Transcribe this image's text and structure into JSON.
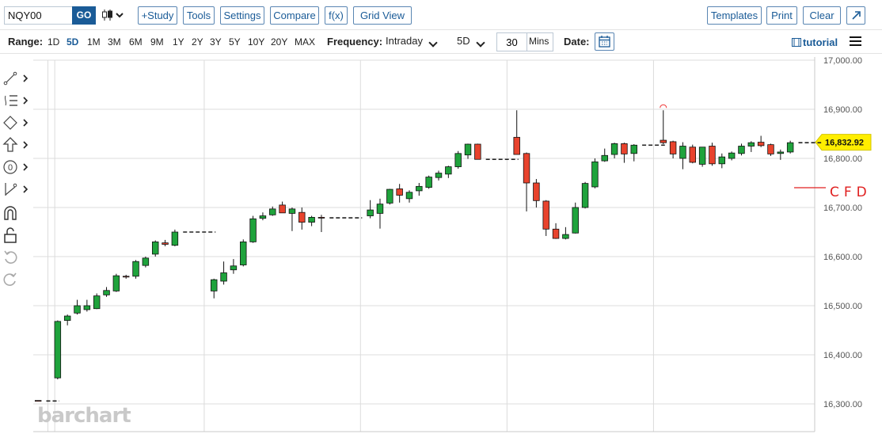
{
  "toolbar": {
    "symbol_value": "NQY00",
    "go_label": "GO",
    "study_label": "+Study",
    "tools_label": "Tools",
    "settings_label": "Settings",
    "compare_label": "Compare",
    "fx_label": "f(x)",
    "gridview_label": "Grid View",
    "templates_label": "Templates",
    "print_label": "Print",
    "clear_label": "Clear",
    "expand_icon": "expand-icon"
  },
  "range_bar": {
    "range_label": "Range:",
    "ranges": [
      "1D",
      "5D",
      "1M",
      "3M",
      "6M",
      "9M",
      "1Y",
      "2Y",
      "3Y",
      "5Y",
      "10Y",
      "20Y",
      "MAX"
    ],
    "active_range": "5D",
    "frequency_label": "Frequency:",
    "frequency_value": "Intraday",
    "period_value": "5D",
    "interval_value": "30",
    "interval_unit": "Mins",
    "date_label": "Date:",
    "tutorial_label": "tutorial"
  },
  "watermark": "barchart",
  "colors": {
    "up": "#1fa33c",
    "down": "#e8432d",
    "accent": "#1a5b97",
    "price_tag": "#ffee00"
  },
  "chart_data": {
    "type": "candlestick",
    "ylim": [
      16285,
      17015
    ],
    "yticks": [
      16300,
      16400,
      16500,
      16600,
      16700,
      16800,
      16900,
      17000
    ],
    "ytick_labels": [
      "16,300.00",
      "16,400.00",
      "16,500.00",
      "16,600.00",
      "16,700.00",
      "16,800.00",
      "16,900.00",
      "17,000.00"
    ],
    "last_price_label": "16,832.92",
    "last_price": 16832.92,
    "annotation_text": "CFD",
    "x_slots": 80,
    "segments": [
      {
        "start": 0,
        "ohlc": [
          [
            16307,
            16307,
            16306,
            16306
          ]
        ],
        "tail": [
          1,
          2
        ]
      },
      {
        "start": 2,
        "ohlc": [
          [
            16353,
            16470,
            16350,
            16468
          ],
          [
            16470,
            16482,
            16460,
            16479
          ],
          [
            16485,
            16512,
            16482,
            16500
          ],
          [
            16492,
            16512,
            16488,
            16500
          ],
          [
            16494,
            16525,
            16493,
            16520
          ],
          [
            16522,
            16538,
            16518,
            16531
          ],
          [
            16530,
            16565,
            16528,
            16561
          ],
          [
            16560,
            16563,
            16555,
            16559
          ],
          [
            16560,
            16593,
            16555,
            16590
          ],
          [
            16582,
            16600,
            16578,
            16597
          ],
          [
            16605,
            16633,
            16600,
            16630
          ],
          [
            16628,
            16634,
            16621,
            16625
          ],
          [
            16623,
            16655,
            16621,
            16650
          ]
        ],
        "tail": [
          15,
          18
        ]
      },
      {
        "start": 18,
        "ohlc": [
          [
            16530,
            16555,
            16515,
            16553
          ],
          [
            16550,
            16590,
            16543,
            16567
          ],
          [
            16573,
            16595,
            16565,
            16581
          ],
          [
            16583,
            16635,
            16580,
            16630
          ],
          [
            16630,
            16683,
            16628,
            16677
          ],
          [
            16678,
            16690,
            16674,
            16683
          ],
          [
            16685,
            16702,
            16683,
            16697
          ],
          [
            16705,
            16712,
            16691,
            16689
          ],
          [
            16688,
            16700,
            16652,
            16697
          ],
          [
            16690,
            16700,
            16655,
            16670
          ],
          [
            16670,
            16683,
            16662,
            16680
          ],
          [
            16680,
            16685,
            16650,
            16679
          ]
        ],
        "tail": [
          30,
          33
        ]
      },
      {
        "start": 34,
        "ohlc": [
          [
            16683,
            16715,
            16678,
            16695
          ],
          [
            16688,
            16718,
            16657,
            16707
          ],
          [
            16709,
            16738,
            16706,
            16737
          ],
          [
            16738,
            16748,
            16710,
            16725
          ],
          [
            16718,
            16735,
            16710,
            16731
          ],
          [
            16734,
            16750,
            16724,
            16743
          ],
          [
            16741,
            16765,
            16738,
            16762
          ],
          [
            16761,
            16775,
            16755,
            16770
          ],
          [
            16768,
            16785,
            16760,
            16783
          ],
          [
            16783,
            16815,
            16779,
            16810
          ],
          [
            16807,
            16830,
            16799,
            16829
          ],
          [
            16829,
            16830,
            16800,
            16798
          ]
        ],
        "tail": [
          46,
          49
        ]
      },
      {
        "start": 49,
        "ohlc": [
          [
            16843,
            16898,
            16808,
            16808
          ],
          [
            16810,
            16812,
            16692,
            16750
          ],
          [
            16750,
            16758,
            16700,
            16714
          ],
          [
            16713,
            16715,
            16642,
            16656
          ],
          [
            16656,
            16668,
            16636,
            16637
          ],
          [
            16637,
            16660,
            16635,
            16645
          ],
          [
            16648,
            16710,
            16647,
            16700
          ],
          [
            16700,
            16752,
            16698,
            16749
          ],
          [
            16742,
            16800,
            16739,
            16793
          ],
          [
            16795,
            16820,
            16793,
            16806
          ],
          [
            16808,
            16832,
            16800,
            16830
          ],
          [
            16830,
            16832,
            16791,
            16809
          ],
          [
            16810,
            16829,
            16794,
            16827
          ]
        ],
        "tail": [
          62,
          64
        ]
      },
      {
        "start": 64,
        "ohlc": [
          [
            16837,
            16898,
            16829,
            16832
          ],
          [
            16834,
            16836,
            16800,
            16809
          ],
          [
            16800,
            16833,
            16778,
            16825
          ],
          [
            16823,
            16828,
            16790,
            16792
          ],
          [
            16788,
            16822,
            16783,
            16823
          ],
          [
            16825,
            16832,
            16785,
            16789
          ],
          [
            16789,
            16810,
            16780,
            16803
          ],
          [
            16800,
            16814,
            16796,
            16811
          ],
          [
            16810,
            16830,
            16806,
            16825
          ],
          [
            16825,
            16835,
            16813,
            16832
          ],
          [
            16833,
            16846,
            16823,
            16826
          ],
          [
            16828,
            16830,
            16805,
            16809
          ],
          [
            16810,
            16818,
            16797,
            16813
          ],
          [
            16813,
            16836,
            16810,
            16832
          ]
        ],
        "tail": [
          78,
          80
        ]
      }
    ]
  }
}
